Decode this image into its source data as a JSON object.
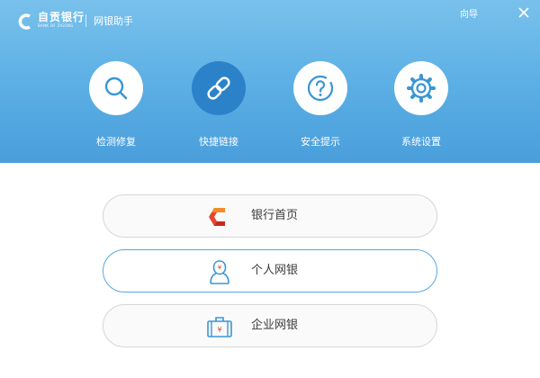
{
  "header": {
    "brand_name": "自贡银行",
    "brand_en": "BANK OF ZIGONG",
    "app_title": "网银助手",
    "guide": "向导",
    "colors": {
      "gradient_top": "#79c1ec",
      "gradient_bottom": "#4a9edb",
      "active_circle": "#2c82c8"
    }
  },
  "tools": [
    {
      "label": "检测修复",
      "icon": "magnifier-icon",
      "active": false
    },
    {
      "label": "快捷链接",
      "icon": "link-icon",
      "active": true
    },
    {
      "label": "安全提示",
      "icon": "question-icon",
      "active": false
    },
    {
      "label": "系统设置",
      "icon": "gear-icon",
      "active": false
    }
  ],
  "entries": [
    {
      "label": "银行首页",
      "icon": "bank-logo-icon",
      "active": false
    },
    {
      "label": "个人网银",
      "icon": "person-icon",
      "active": true
    },
    {
      "label": "企业网银",
      "icon": "briefcase-icon",
      "active": false
    }
  ]
}
